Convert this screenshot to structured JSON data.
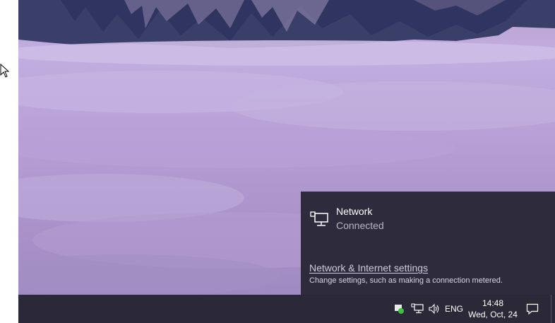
{
  "network_flyout": {
    "network_name": "Network",
    "network_status": "Connected",
    "settings_link": "Network & Internet settings",
    "settings_description": "Change settings, such as making a connection metered."
  },
  "taskbar": {
    "language": "ENG",
    "time": "14:48",
    "date": "Wed, Oct, 24"
  },
  "icons": {
    "tray": [
      "security-icon",
      "network-icon",
      "volume-icon",
      "action-center-icon"
    ],
    "flyout": "ethernet-network-icon",
    "pointer": "mouse-cursor-icon"
  },
  "colors": {
    "taskbar_bg": "#2b2838",
    "flyout_bg": "#2e2b3c",
    "wallpaper_sky": "#c2aee0",
    "mountain": "#3a3f6a",
    "security_ok": "#3cc23c"
  }
}
